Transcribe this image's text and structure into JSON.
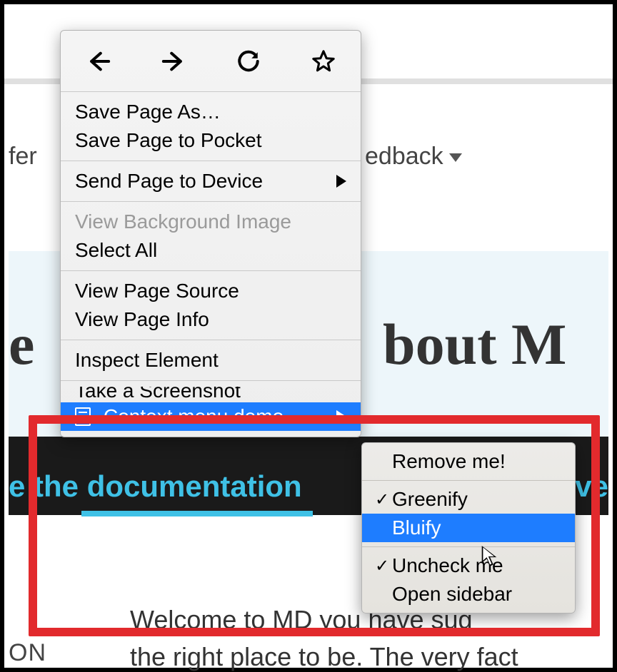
{
  "background": {
    "nav_left_fragment": "fer",
    "nav_right_fragment": "edback",
    "heading_left_fragment": "e",
    "heading_right_fragment": "bout M",
    "dark_link_left": "e the documentation",
    "dark_link_right_fragment": "nve",
    "body_line1": "Welcome to MD           you have sug",
    "body_line2": "the right place to be. The very fact",
    "left_fragment": "ON"
  },
  "context_menu": {
    "icons": [
      "back",
      "forward",
      "reload",
      "bookmark"
    ],
    "groups": [
      {
        "items": [
          {
            "label": "Save Page As…",
            "enabled": true
          },
          {
            "label": "Save Page to Pocket",
            "enabled": true
          }
        ]
      },
      {
        "items": [
          {
            "label": "Send Page to Device",
            "enabled": true,
            "submenu": true
          }
        ]
      },
      {
        "items": [
          {
            "label": "View Background Image",
            "enabled": false
          },
          {
            "label": "Select All",
            "enabled": true
          }
        ]
      },
      {
        "items": [
          {
            "label": "View Page Source",
            "enabled": true
          },
          {
            "label": "View Page Info",
            "enabled": true
          }
        ]
      },
      {
        "items": [
          {
            "label": "Inspect Element",
            "enabled": true
          }
        ]
      },
      {
        "items": [
          {
            "label": "Take a Screenshot",
            "enabled": true,
            "clipped": true
          },
          {
            "label": "Context menu demo",
            "enabled": true,
            "submenu": true,
            "highlight": true,
            "icon": "page"
          }
        ]
      }
    ]
  },
  "submenu": {
    "groups": [
      {
        "items": [
          {
            "label": "Remove me!",
            "checked": false
          }
        ]
      },
      {
        "items": [
          {
            "label": "Greenify",
            "checked": true
          },
          {
            "label": "Bluify",
            "checked": false,
            "highlight": true
          }
        ]
      },
      {
        "items": [
          {
            "label": "Uncheck me",
            "checked": true
          },
          {
            "label": "Open sidebar",
            "checked": false
          }
        ]
      }
    ]
  }
}
